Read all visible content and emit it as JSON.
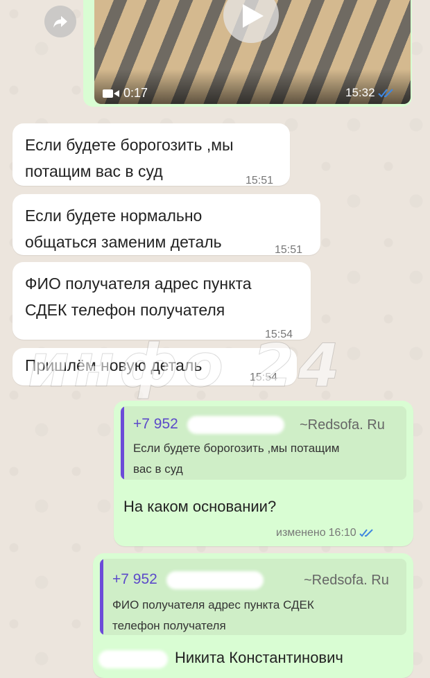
{
  "video": {
    "duration": "0:17",
    "time": "15:32"
  },
  "messages": [
    {
      "text": "Если будете борогозить ,мы\nпотащим вас в суд",
      "time": "15:51"
    },
    {
      "text": "Если будете нормально\nобщаться заменим деталь",
      "time": "15:51"
    },
    {
      "text": "ФИО получателя адрес пункта\nСДЕК телефон получателя",
      "time": "15:54"
    },
    {
      "text": "Пришлём новую деталь",
      "time": "15:54"
    }
  ],
  "replies": [
    {
      "quote_sender": "+7 952",
      "quote_name": "~Redsofa. Ru",
      "quote_text": "Если будете борогозить ,мы потащим\nвас в суд",
      "text": "На каком основании?",
      "edited_label": "изменено",
      "time": "16:10"
    },
    {
      "quote_sender": "+7 952",
      "quote_name": "~Redsofa. Ru",
      "quote_text": "ФИО получателя адрес пункта СДЕК\nтелефон получателя",
      "text": "Никита Константинович"
    }
  ],
  "watermark": "инфо 24",
  "colors": {
    "chat_bg": "#ece5dd",
    "incoming": "#ffffff",
    "outgoing": "#d9fdd3",
    "quote_accent": "#6c4bd8",
    "read_ticks": "#3f87e0"
  }
}
